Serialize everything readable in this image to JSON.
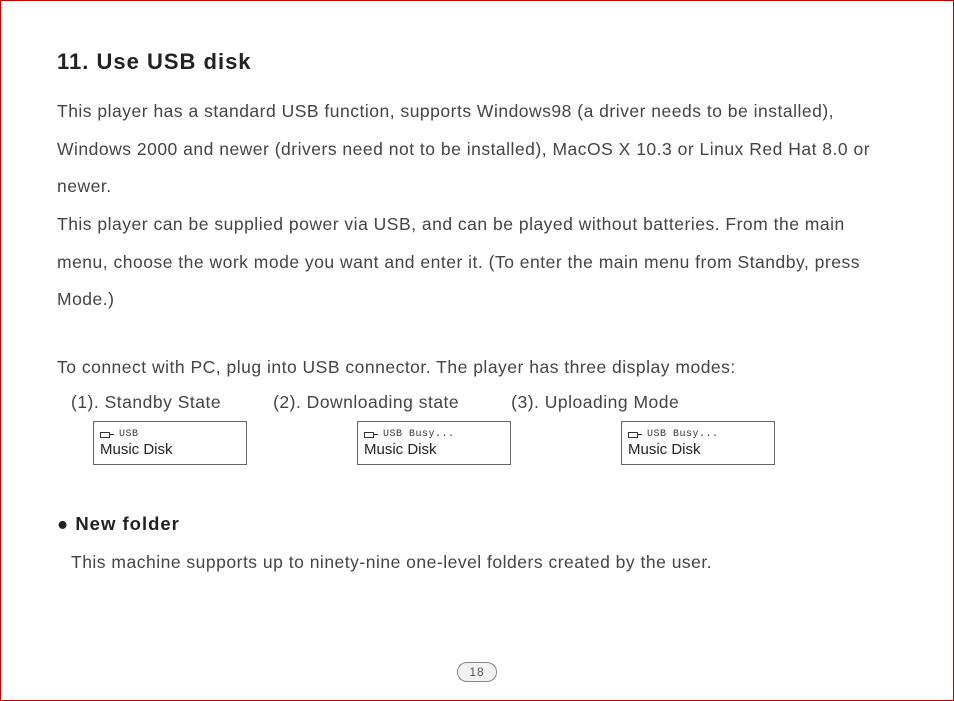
{
  "section": {
    "title": "11. Use USB disk",
    "para1": "This player has a standard USB function, supports Windows98 (a driver needs to be installed), Windows 2000 and newer (drivers need not to be installed), MacOS X 10.3 or Linux Red Hat 8.0 or newer.",
    "para2": "This player can be supplied power via USB, and can be played without batteries. From the main menu, choose the work mode you want and enter it.  (To enter the main menu from Standby, press Mode.)",
    "para3": "To connect with PC, plug into USB connector. The player has three display modes:",
    "modes": [
      {
        "label": "(1). Standby State",
        "top": "USB",
        "bottom": "Music Disk"
      },
      {
        "label": "(2). Downloading state",
        "top": "USB Busy...",
        "bottom": "Music Disk"
      },
      {
        "label": "(3). Uploading Mode",
        "top": "USB Busy...",
        "bottom": "Music Disk"
      }
    ],
    "newFolder": {
      "heading": "● New folder",
      "text": "This machine supports up to ninety-nine one-level folders created by the user."
    }
  },
  "pageNumber": "18"
}
